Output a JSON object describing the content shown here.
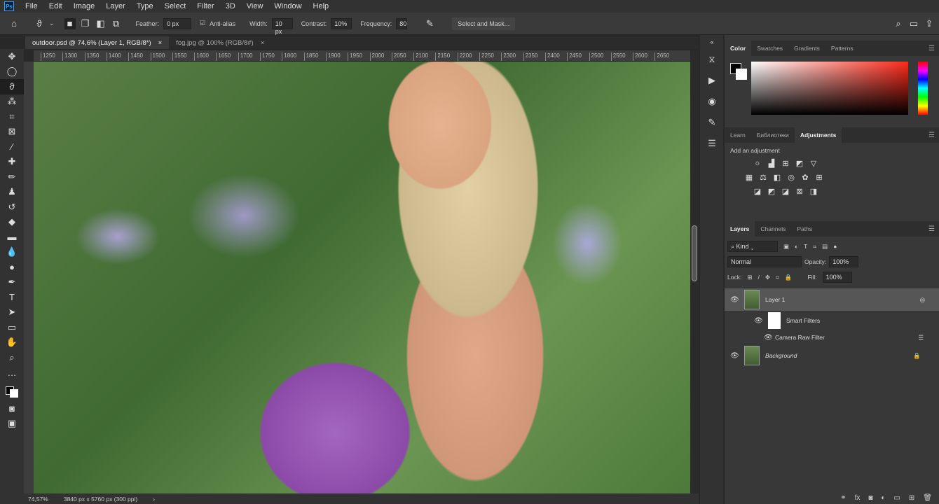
{
  "menu": [
    "File",
    "Edit",
    "Image",
    "Layer",
    "Type",
    "Select",
    "Filter",
    "3D",
    "View",
    "Window",
    "Help"
  ],
  "options": {
    "feather_label": "Feather:",
    "feather_value": "0 px",
    "antialias_label": "Anti-alias",
    "width_label": "Width:",
    "width_value": "10 px",
    "contrast_label": "Contrast:",
    "contrast_value": "10%",
    "frequency_label": "Frequency:",
    "frequency_value": "80",
    "select_mask": "Select and Mask..."
  },
  "tabs": [
    {
      "label": "outdoor.psd @ 74,6% (Layer 1, RGB/8*)"
    },
    {
      "label": "fog.jpg @ 100% (RGB/8#)"
    }
  ],
  "ruler_h": [
    "1250",
    "1300",
    "1350",
    "1400",
    "1450",
    "1500",
    "1550",
    "1600",
    "1650",
    "1700",
    "1750",
    "1800",
    "1850",
    "1900",
    "1950",
    "2000",
    "2050",
    "2100",
    "2150",
    "2200",
    "2250",
    "2300",
    "2350",
    "2400",
    "2450",
    "2500",
    "2550",
    "2600",
    "2650"
  ],
  "status": {
    "zoom": "74,57%",
    "doc": "3840 px x 5760 px (300 ppi)"
  },
  "color_tabs": [
    "Color",
    "Swatches",
    "Gradients",
    "Patterns"
  ],
  "adj_tabs": [
    "Learn",
    "Библиотеки",
    "Adjustments"
  ],
  "adj_label": "Add an adjustment",
  "layers_tabs": [
    "Layers",
    "Channels",
    "Paths"
  ],
  "layers": {
    "filter_kind": "Kind",
    "blend": "Normal",
    "opacity_label": "Opacity:",
    "opacity": "100%",
    "lock_label": "Lock:",
    "fill_label": "Fill:",
    "fill": "100%",
    "items": [
      {
        "name": "Layer 1"
      },
      {
        "name": "Smart Filters"
      },
      {
        "name": "Camera Raw Filter"
      },
      {
        "name": "Background"
      }
    ]
  },
  "colors": {
    "accent": "#31a8ff",
    "panel": "#383838"
  }
}
